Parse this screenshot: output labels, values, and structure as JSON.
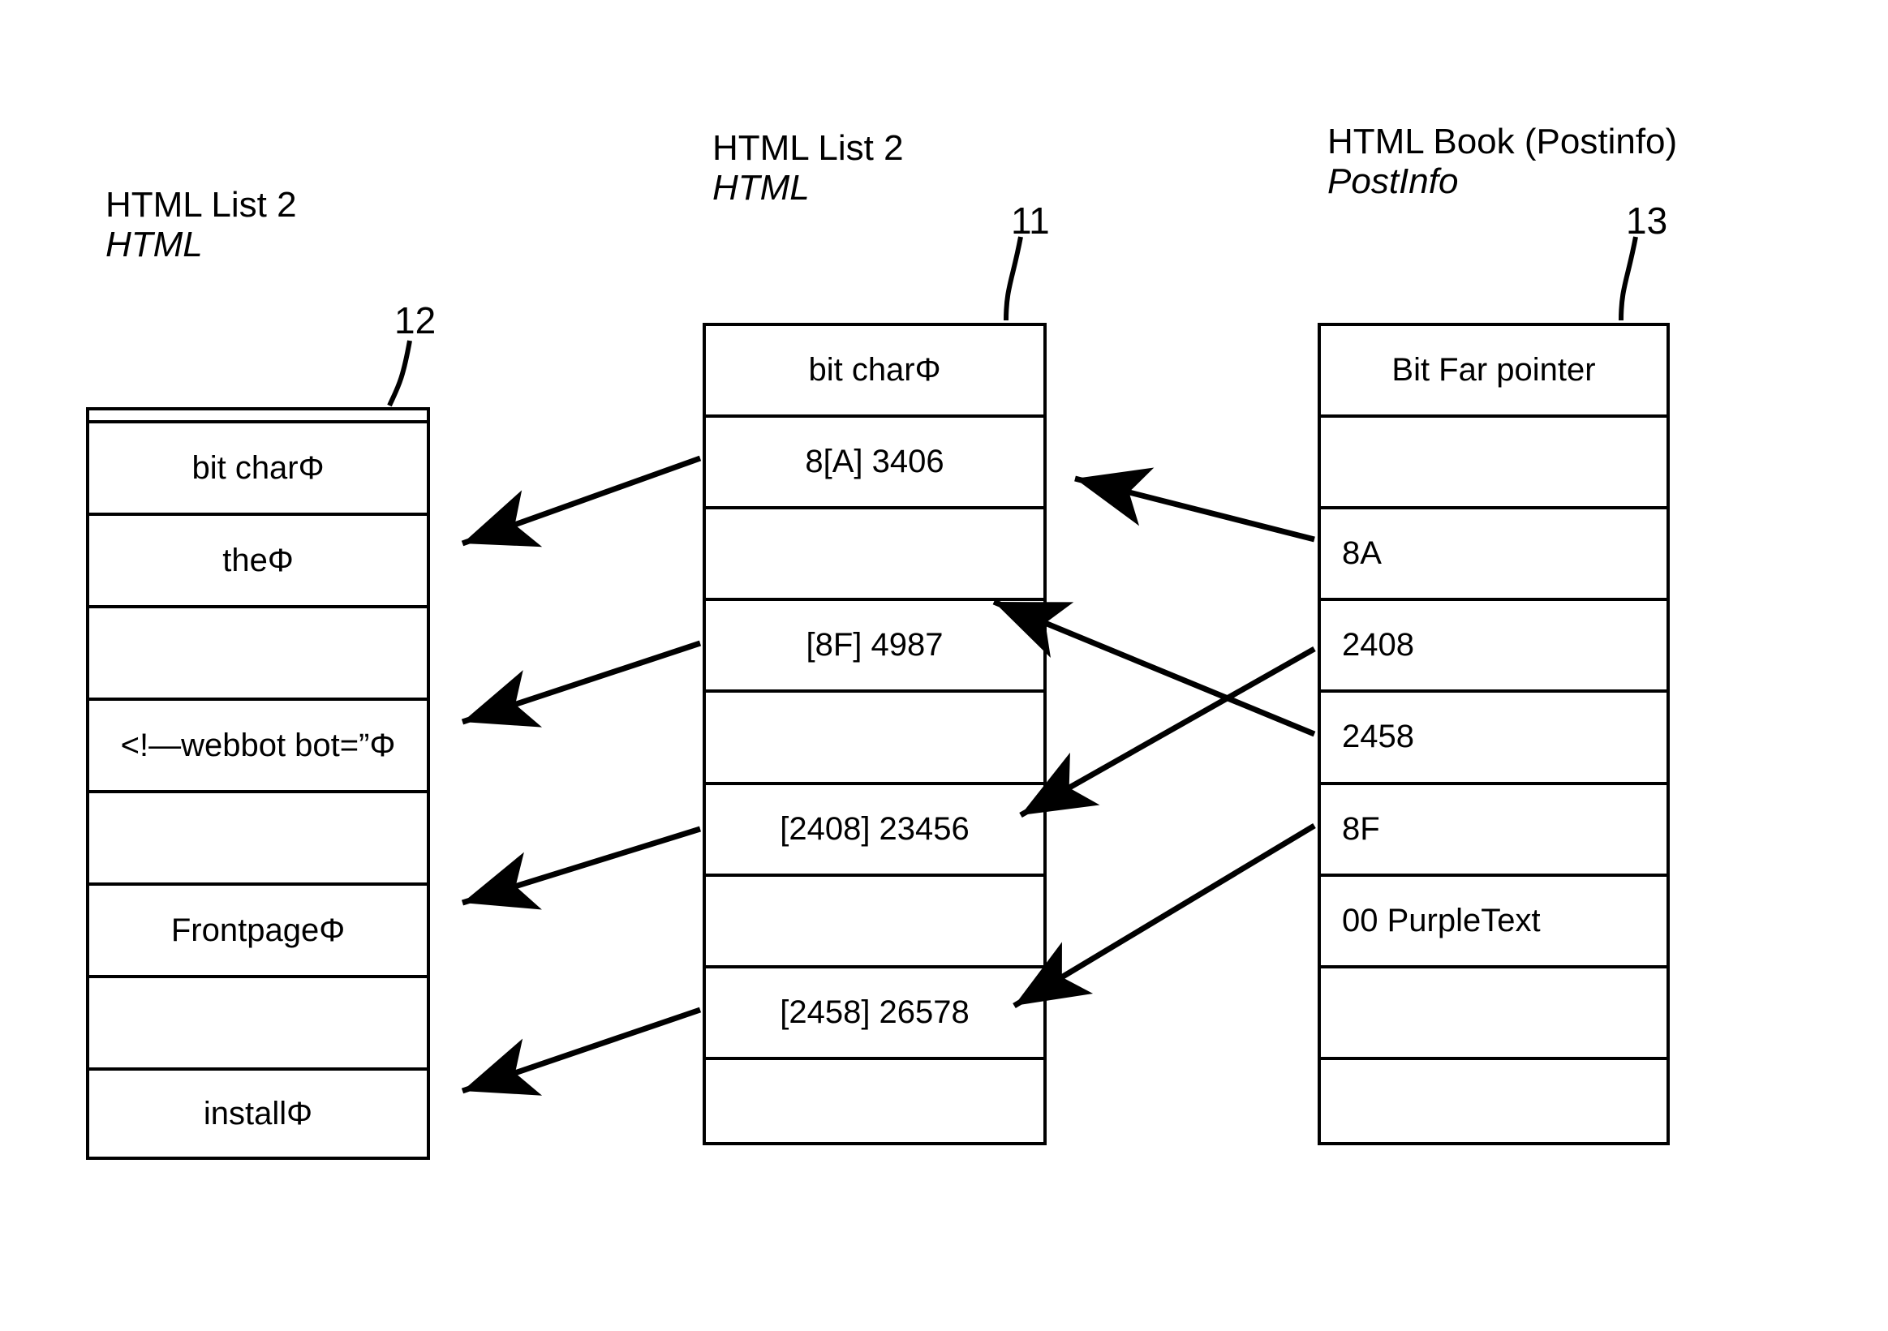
{
  "figure": {
    "background": "#ffffff",
    "line_color": "#000000"
  },
  "columns": [
    {
      "id": "left",
      "ref": "12",
      "title": "HTML List 2",
      "subtitle": "HTML",
      "cells": [
        {
          "text": "",
          "align": "center",
          "kind": "sliver"
        },
        {
          "text": "bit charΦ",
          "align": "center",
          "kind": "normal"
        },
        {
          "text": "theΦ",
          "align": "center",
          "kind": "normal"
        },
        {
          "text": "",
          "align": "center",
          "kind": "normal"
        },
        {
          "text": "<!—webbot bot=”Φ",
          "align": "center",
          "kind": "normal"
        },
        {
          "text": "",
          "align": "center",
          "kind": "normal"
        },
        {
          "text": "FrontpageΦ",
          "align": "center",
          "kind": "normal"
        },
        {
          "text": "",
          "align": "center",
          "kind": "normal"
        },
        {
          "text": "installΦ",
          "align": "center",
          "kind": "normal"
        }
      ]
    },
    {
      "id": "middle",
      "ref": "11",
      "title": "HTML List 2",
      "subtitle": "HTML",
      "cells": [
        {
          "text": "bit charΦ",
          "align": "center",
          "kind": "normal"
        },
        {
          "text": "8[A] 3406",
          "align": "center",
          "kind": "normal"
        },
        {
          "text": "",
          "align": "center",
          "kind": "normal"
        },
        {
          "text": "[8F] 4987",
          "align": "center",
          "kind": "normal"
        },
        {
          "text": "",
          "align": "center",
          "kind": "normal"
        },
        {
          "text": "[2408] 23456",
          "align": "center",
          "kind": "normal"
        },
        {
          "text": "",
          "align": "center",
          "kind": "normal"
        },
        {
          "text": "[2458] 26578",
          "align": "center",
          "kind": "normal"
        },
        {
          "text": "",
          "align": "center",
          "kind": "normal"
        }
      ]
    },
    {
      "id": "right",
      "ref": "13",
      "title": "HTML Book (Postinfo)",
      "subtitle": "PostInfo",
      "cells": [
        {
          "text": "Bit Far pointer",
          "align": "center",
          "kind": "normal"
        },
        {
          "text": "",
          "align": "left",
          "kind": "normal"
        },
        {
          "text": "8A",
          "align": "left",
          "kind": "normal"
        },
        {
          "text": "2408",
          "align": "left",
          "kind": "normal"
        },
        {
          "text": "2458",
          "align": "left",
          "kind": "normal"
        },
        {
          "text": "8F",
          "align": "left",
          "kind": "normal"
        },
        {
          "text": "00 PurpleText",
          "align": "left",
          "kind": "normal"
        },
        {
          "text": "",
          "align": "left",
          "kind": "normal"
        },
        {
          "text": "",
          "align": "left",
          "kind": "normal"
        }
      ]
    }
  ],
  "connectors": [
    {
      "name": "middle-to-left-bitchar",
      "from": "middle-left-edge",
      "to": "left-right-edge"
    },
    {
      "name": "middle-to-left-webbot",
      "from": "middle-left-edge",
      "to": "left-right-edge"
    },
    {
      "name": "middle-to-left-frontpage",
      "from": "middle-left-edge",
      "to": "left-right-edge"
    },
    {
      "name": "middle-to-left-install",
      "from": "middle-left-edge",
      "to": "left-right-edge"
    },
    {
      "name": "right-to-middle-8a",
      "from": "right-left-edge",
      "to": "middle-right-edge"
    },
    {
      "name": "right-to-middle-8f",
      "from": "right-left-edge",
      "to": "middle-right-edge"
    },
    {
      "name": "right-to-middle-2408",
      "from": "right-left-edge",
      "to": "middle-right-edge"
    },
    {
      "name": "right-to-middle-2458",
      "from": "right-left-edge",
      "to": "middle-right-edge"
    }
  ]
}
